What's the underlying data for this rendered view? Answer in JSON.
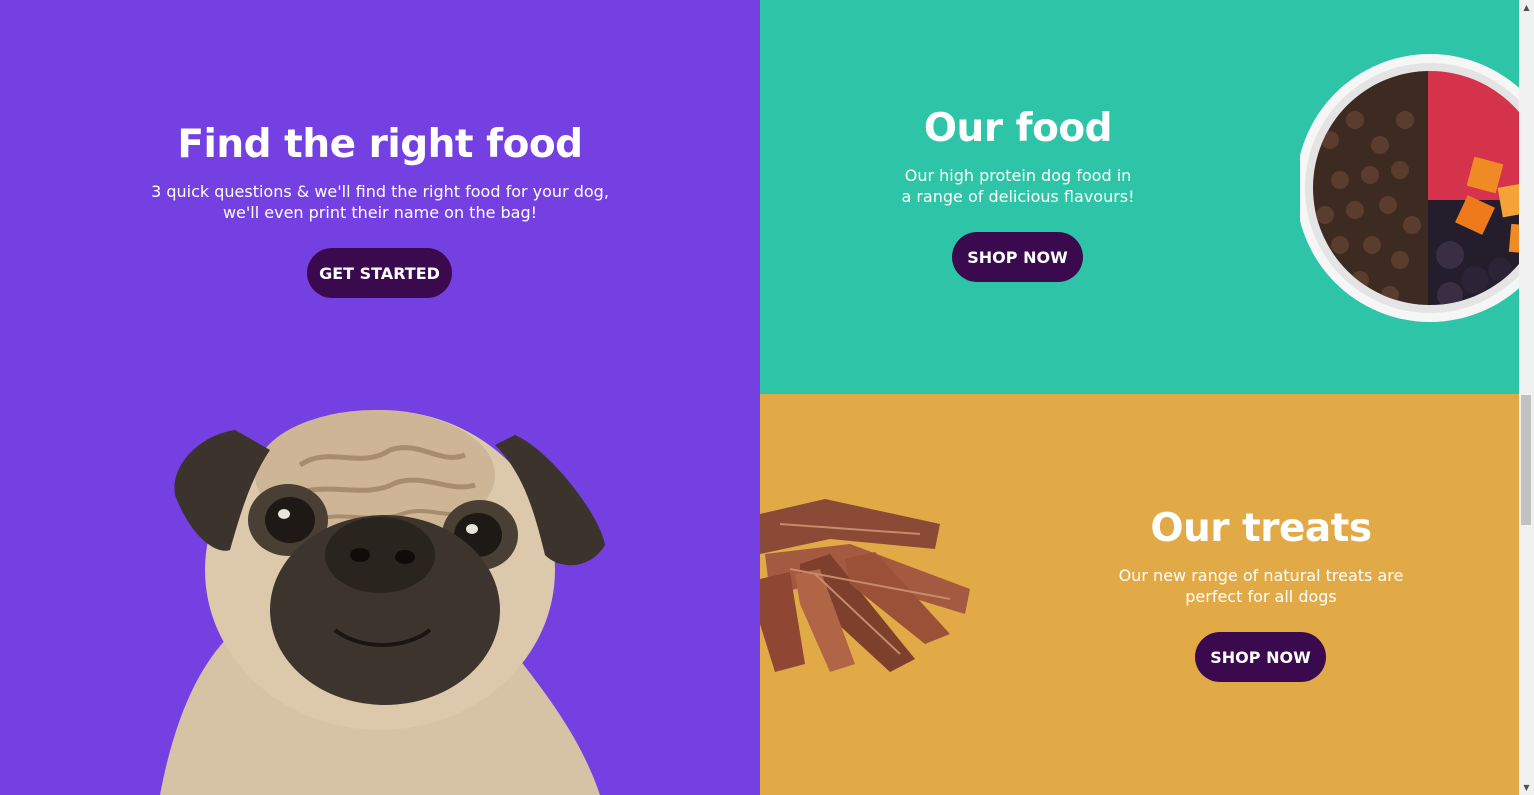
{
  "find_food": {
    "title": "Find the right food",
    "description": "3 quick questions & we'll find the right food for your dog, we'll even print their name on the bag!",
    "button_label": "GET STARTED"
  },
  "our_food": {
    "title": "Our food",
    "description": "Our high protein dog food in a range of delicious flavours!",
    "button_label": "SHOP NOW"
  },
  "our_treats": {
    "title": "Our treats",
    "description": "Our new range of natural treats are perfect for all dogs",
    "button_label": "SHOP NOW"
  },
  "colors": {
    "purple_panel": "#7540e2",
    "teal_panel": "#2ec4a7",
    "mustard_panel": "#e1aa46",
    "button_background": "#3b0a4e",
    "text": "#ffffff"
  },
  "scrollbar": {
    "position_fraction": 0.5
  }
}
